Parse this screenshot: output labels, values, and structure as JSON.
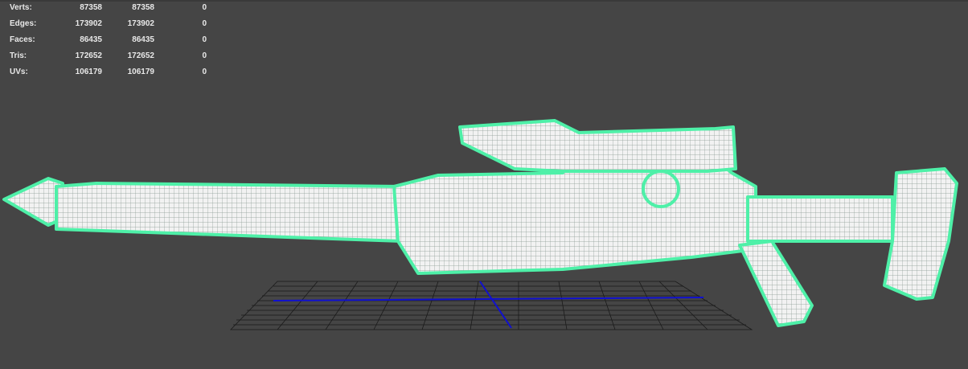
{
  "hud": {
    "rows": [
      {
        "label": "Verts:",
        "total": "87358",
        "selected": "87358",
        "extra": "0"
      },
      {
        "label": "Edges:",
        "total": "173902",
        "selected": "173902",
        "extra": "0"
      },
      {
        "label": "Faces:",
        "total": "86435",
        "selected": "86435",
        "extra": "0"
      },
      {
        "label": "Tris:",
        "total": "172652",
        "selected": "172652",
        "extra": "0"
      },
      {
        "label": "UVs:",
        "total": "106179",
        "selected": "106179",
        "extra": "0"
      }
    ]
  },
  "colors": {
    "background": "#454545",
    "selection": "#4ef0a8",
    "grid": "#1a1a1a",
    "axis": "#1010d0"
  }
}
